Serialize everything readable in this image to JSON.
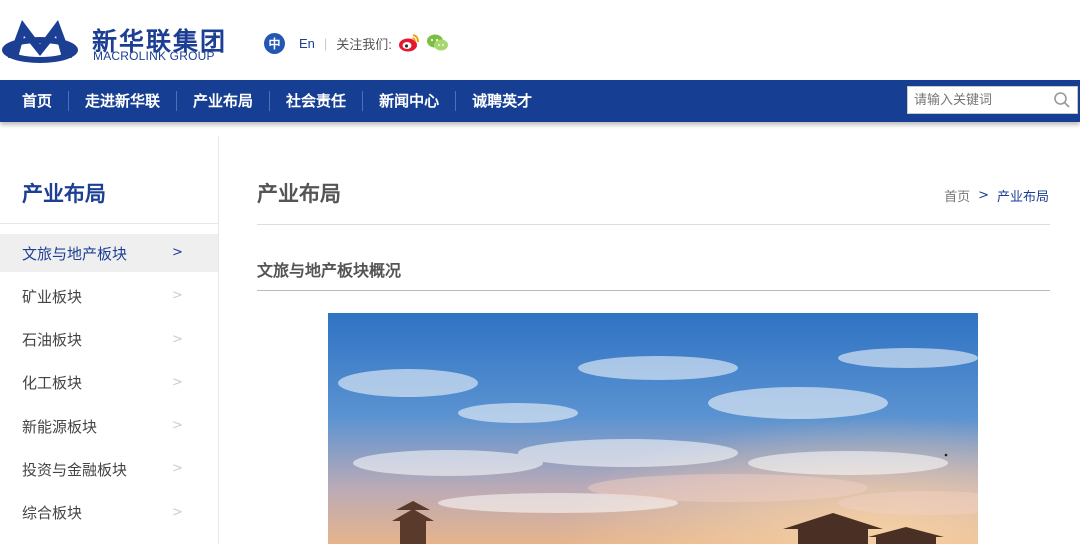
{
  "brand": {
    "name_cn": "新华联集团",
    "name_en": "MACROLINK GROUP",
    "color": "#1c3f94"
  },
  "header": {
    "lang_cn": "中",
    "lang_en": "En",
    "follow_label": "关注我们:",
    "social": [
      "weibo-icon",
      "wechat-icon"
    ]
  },
  "nav": {
    "items": [
      {
        "label": "首页"
      },
      {
        "label": "走进新华联"
      },
      {
        "label": "产业布局"
      },
      {
        "label": "社会责任"
      },
      {
        "label": "新闻中心"
      },
      {
        "label": "诚聘英才"
      }
    ],
    "active_index": 2,
    "background": "#163e93"
  },
  "search": {
    "placeholder": "请输入关键词"
  },
  "sidebar": {
    "title": "产业布局",
    "items": [
      {
        "label": "文旅与地产板块"
      },
      {
        "label": "矿业板块"
      },
      {
        "label": "石油板块"
      },
      {
        "label": "化工板块"
      },
      {
        "label": "新能源板块"
      },
      {
        "label": "投资与金融板块"
      },
      {
        "label": "综合板块"
      }
    ],
    "active_index": 0,
    "chevron": ">"
  },
  "main": {
    "title": "产业布局",
    "breadcrumb": {
      "home": "首页",
      "sep": ">",
      "current": "产业布局"
    },
    "section_title": "文旅与地产板块概况"
  }
}
